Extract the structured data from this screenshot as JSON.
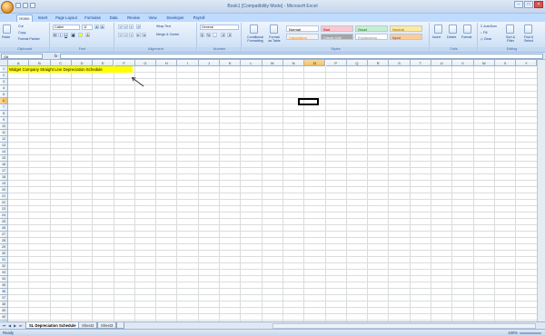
{
  "window": {
    "title": "Book1 [Compatibility Mode] - Microsoft Excel"
  },
  "tabs": [
    "Home",
    "Insert",
    "Page Layout",
    "Formulas",
    "Data",
    "Review",
    "View",
    "Developer",
    "Payroll"
  ],
  "ribbon": {
    "clipboard": {
      "paste": "Paste",
      "cut": "Cut",
      "copy": "Copy",
      "format_painter": "Format Painter",
      "label": "Clipboard"
    },
    "font": {
      "name": "Calibri",
      "size": "11",
      "label": "Font"
    },
    "alignment": {
      "wrap": "Wrap Text",
      "merge": "Merge & Center",
      "label": "Alignment"
    },
    "number": {
      "format": "General",
      "label": "Number"
    },
    "styles": {
      "conditional": "Conditional Formatting",
      "format_table": "Format as Table",
      "cells": [
        {
          "text": "Normal",
          "bg": "#ffffff",
          "color": "#000000"
        },
        {
          "text": "Bad",
          "bg": "#ffc7ce",
          "color": "#9c0006"
        },
        {
          "text": "Good",
          "bg": "#c6efce",
          "color": "#006100"
        },
        {
          "text": "Neutral",
          "bg": "#ffeb9c",
          "color": "#9c6500"
        },
        {
          "text": "Calculation",
          "bg": "#f2f2f2",
          "color": "#fa7d00"
        },
        {
          "text": "Check Cell",
          "bg": "#a5a5a5",
          "color": "#ffffff"
        },
        {
          "text": "Explanatory ...",
          "bg": "#ffffff",
          "color": "#7f7f7f"
        },
        {
          "text": "Input",
          "bg": "#ffcc99",
          "color": "#3f3f76"
        }
      ],
      "label": "Styles"
    },
    "cells": {
      "insert": "Insert",
      "delete": "Delete",
      "format": "Format",
      "label": "Cells"
    },
    "editing": {
      "autosum": "AutoSum",
      "fill": "Fill",
      "clear": "Clear",
      "sort": "Sort & Filter",
      "find": "Find & Select",
      "label": "Editing"
    }
  },
  "formula_bar": {
    "name_box": "O6",
    "fx": "fx",
    "content": ""
  },
  "columns": [
    "A",
    "B",
    "C",
    "D",
    "E",
    "F",
    "G",
    "H",
    "I",
    "J",
    "K",
    "L",
    "M",
    "N",
    "O",
    "P",
    "Q",
    "R",
    "S",
    "T",
    "U",
    "V",
    "W",
    "X",
    "Y"
  ],
  "selected_column": "O",
  "selected_row": 6,
  "row_count": 46,
  "cell_a1": "Widget Company Straight Line Depreciation Schedule",
  "sheets": [
    "SL Depreciation Schedule",
    "Sheet2",
    "Sheet3"
  ],
  "active_sheet": "SL Depreciation Schedule",
  "status": {
    "ready": "Ready",
    "zoom": "100%"
  }
}
